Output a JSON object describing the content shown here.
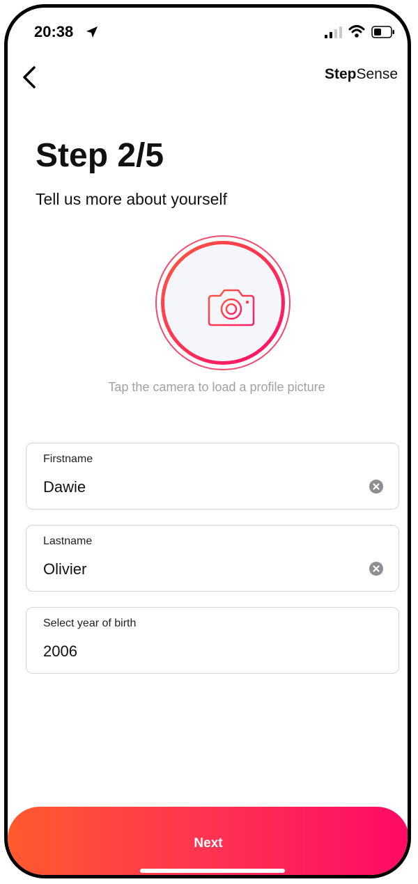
{
  "status_bar": {
    "time": "20:38"
  },
  "header": {
    "brand_bold": "Step",
    "brand_regular": "Sense"
  },
  "main": {
    "title": "Step 2/5",
    "subtitle": "Tell us more about yourself",
    "avatar_hint": "Tap the camera to load a profile picture"
  },
  "fields": {
    "firstname": {
      "label": "Firstname",
      "value": "Dawie"
    },
    "lastname": {
      "label": "Lastname",
      "value": "Olivier"
    },
    "birth_year": {
      "label": "Select year of birth",
      "value": "2006"
    }
  },
  "footer": {
    "next_label": "Next"
  },
  "colors": {
    "gradient_start": "#ff5a2e",
    "gradient_end": "#ff0a66",
    "hint_text": "#a0a0a6"
  },
  "icons": [
    "location-arrow-icon",
    "signal-icon",
    "wifi-icon",
    "battery-icon",
    "back-chevron-icon",
    "camera-icon",
    "clear-icon"
  ]
}
